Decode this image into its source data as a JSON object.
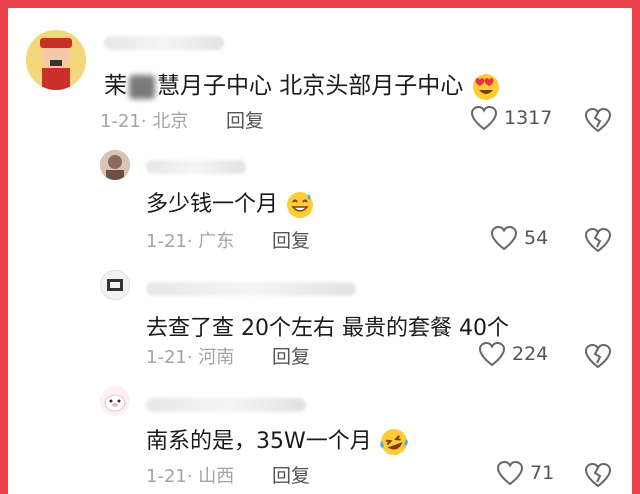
{
  "colors": {
    "frame": "#e9404a",
    "meta": "#a3a3a3",
    "text": "#1a1a1a"
  },
  "comments": [
    {
      "text_before": "茉",
      "text_after": "慧月子中心 北京头部月子中心",
      "emoji": "heart-eyes-emoji",
      "date_location": "1-21· 北京",
      "reply": "回复",
      "likes": "1317"
    },
    {
      "text": "多少钱一个月",
      "emoji": "sweat-smile-emoji",
      "date_location": "1-21· 广东",
      "reply": "回复",
      "likes": "54"
    },
    {
      "text": "去查了查  20个左右  最贵的套餐 40个",
      "date_location": "1-21· 河南",
      "reply": "回复",
      "likes": "224"
    },
    {
      "text": "南系的是，35W一个月",
      "emoji": "laughing-tears-emoji",
      "date_location": "1-21· 山西",
      "reply": "回复",
      "likes": "71"
    }
  ]
}
